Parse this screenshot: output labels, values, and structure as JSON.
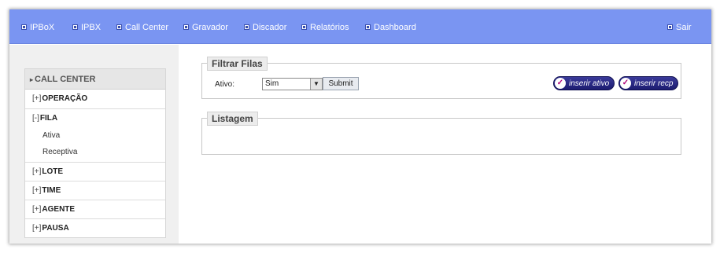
{
  "nav": {
    "items": [
      {
        "label": "IPBoX"
      },
      {
        "label": "IPBX"
      },
      {
        "label": "Call Center"
      },
      {
        "label": "Gravador"
      },
      {
        "label": "Discador"
      },
      {
        "label": "Relatórios"
      },
      {
        "label": "Dashboard"
      }
    ],
    "logout": "Sair"
  },
  "sidebar": {
    "title": "CALL CENTER",
    "groups": [
      {
        "toggle": "[+]",
        "label": "OPERAÇÃO"
      },
      {
        "toggle": "[-]",
        "label": "FILA",
        "subitems": [
          "Ativa",
          "Receptiva"
        ]
      },
      {
        "toggle": "[+]",
        "label": "LOTE"
      },
      {
        "toggle": "[+]",
        "label": "TIME"
      },
      {
        "toggle": "[+]",
        "label": "AGENTE"
      },
      {
        "toggle": "[+]",
        "label": "PAUSA"
      }
    ]
  },
  "filter": {
    "legend": "Filtrar Filas",
    "label": "Ativo:",
    "selected": "Sim",
    "submit": "Submit",
    "buttons": [
      "inserir ativo",
      "inserir recp"
    ]
  },
  "listing": {
    "legend": "Listagem"
  },
  "colors": {
    "topbar": "#7a95f2",
    "pill": "#1c1c70",
    "check": "#b1007a"
  }
}
